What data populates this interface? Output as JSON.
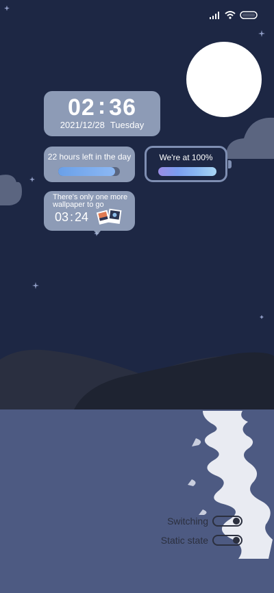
{
  "status_bar": {
    "icons": [
      "signal-icon",
      "wifi-icon",
      "battery-icon"
    ]
  },
  "clock": {
    "hour": "02",
    "minute": "36",
    "date": "2021/12/28",
    "weekday": "Tuesday"
  },
  "day_progress": {
    "label": "22 hours left in the day",
    "fraction": 0.92
  },
  "battery": {
    "label": "We're at 100%",
    "fraction": 1.0
  },
  "wallpaper": {
    "label": "There's only one more wallpaper to go",
    "minutes": "03",
    "seconds": "24",
    "icon": "photos-icon"
  },
  "toggles": [
    {
      "label": "Switching",
      "state": "on"
    },
    {
      "label": "Static state",
      "state": "on"
    }
  ],
  "colors": {
    "sky": "#1d2744",
    "water": "#4d5a82",
    "moon": "#ffffff"
  }
}
